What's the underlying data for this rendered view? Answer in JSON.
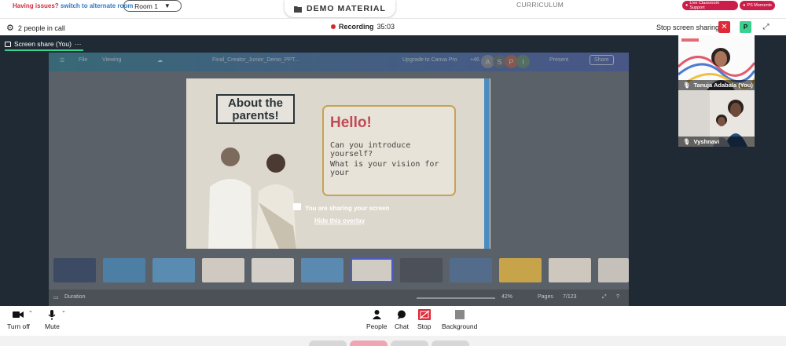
{
  "topbar": {
    "issues_text": "Having issues?",
    "alternate_room_link": "switch to alternate room",
    "room_select_value": "Room 1",
    "demo_tab_label": "DEMO MATERIAL",
    "curriculum_label": "CURRICULUM",
    "live_support_label": "Live Classroom Support",
    "ps_moments_label": "PS Moments"
  },
  "callbar": {
    "people_count": "2 people in call",
    "recording_label": "Recording",
    "recording_time": "35:03",
    "stop_sharing_label": "Stop screen sharing",
    "participant_initial": "P"
  },
  "stage": {
    "share_label": "Screen share (You)",
    "share_menu": "···",
    "canva": {
      "file": "File",
      "viewing": "Viewing",
      "doc_title": "Final_Creator_Junior_Demo_PPT...",
      "upgrade": "Upgrade to Canva Pro",
      "avatar_count": "+46",
      "avatars": [
        "A",
        "S",
        "P",
        "I"
      ],
      "present": "Present",
      "share": "Share"
    },
    "slide": {
      "about_line1": "About the",
      "about_line2": "parents!",
      "hello": "Hello!",
      "q1": "Can you introduce yourself?",
      "q2": "What is your vision for your"
    },
    "overlay_text": "You are sharing your screen",
    "overlay_link": "Hide this overlay",
    "bottom": {
      "duration": "Duration",
      "zoom": "42%",
      "pages": "Pages",
      "page_count": "7/123"
    }
  },
  "tiles": [
    {
      "name": "Tanuja Adabala (You)"
    },
    {
      "name": "Vyshnavi"
    }
  ],
  "controls": {
    "camera": "Turn off",
    "mic": "Mute",
    "people": "People",
    "chat": "Chat",
    "stop": "Stop",
    "background": "Background"
  },
  "colors": {
    "accent_green": "#3ad08e",
    "danger_red": "#e02838",
    "pill_pink": "#cc1e4a"
  }
}
